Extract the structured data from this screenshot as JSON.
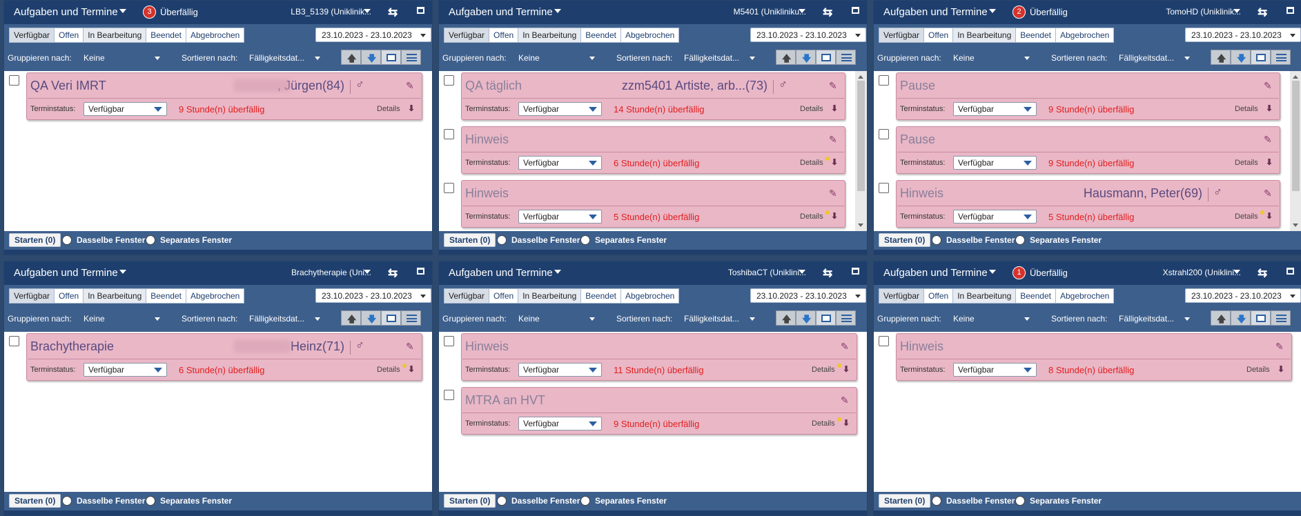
{
  "common": {
    "title": "Aufgaben und Termine",
    "tabs": [
      "Verfügbar",
      "Offen",
      "In Bearbeitung",
      "Beendet",
      "Abgebrochen"
    ],
    "date_range": "23.10.2023 - 23.10.2023",
    "group_label": "Gruppieren nach:",
    "group_value": "Keine",
    "sort_label": "Sortieren nach:",
    "sort_value": "Fälligkeitsdat...",
    "status_label": "Terminstatus:",
    "status_value": "Verfügbar",
    "details": "Details",
    "start_button": "Starten (0)",
    "same_window": "Dasselbe Fenster",
    "separate_window": "Separates Fenster",
    "overdue_text": "Überfällig",
    "colors": {
      "titlebar": "#1e3f6e",
      "toolbar": "#3d5f8c",
      "card": "#e9b7c6",
      "overdue": "#e31d1d",
      "badge": "#d4332c"
    }
  },
  "panels": [
    {
      "device": "LB3_5139 (Uniklinik...",
      "badge": "3",
      "tasks": [
        {
          "title": "QA Veri IMRT",
          "patient": ", Jürgen",
          "age": "(84)",
          "overdue": "9 Stunde(n) überfällig",
          "has_dot": false
        }
      ]
    },
    {
      "device": "M5401 (Unikliniku...",
      "badge": "",
      "tasks": [
        {
          "title": "QA täglich",
          "patient": "zzm5401 Artiste, arb...",
          "age": "(73)",
          "overdue": "14 Stunde(n) überfällig",
          "has_dot": false
        },
        {
          "title": "Hinweis",
          "patient": "",
          "age": "",
          "overdue": "6 Stunde(n) überfällig",
          "has_dot": true
        },
        {
          "title": "Hinweis",
          "patient": "",
          "age": "",
          "overdue": "5 Stunde(n) überfällig",
          "has_dot": true
        }
      ]
    },
    {
      "device": "TomoHD (Uniklinik...",
      "badge": "2",
      "tasks": [
        {
          "title": "Pause",
          "patient": "",
          "age": "",
          "overdue": "9 Stunde(n) überfällig",
          "has_dot": false
        },
        {
          "title": "Pause",
          "patient": "",
          "age": "",
          "overdue": "9 Stunde(n) überfällig",
          "has_dot": false
        },
        {
          "title": "Hinweis",
          "patient": "Hausmann, Peter",
          "age": "(69)",
          "overdue": "5 Stunde(n) überfällig",
          "has_dot": true
        }
      ]
    },
    {
      "device": "Brachytherapie (Uni...",
      "badge": "",
      "tasks": [
        {
          "title": "Brachytherapie",
          "patient": "Heinz",
          "age": "(71)",
          "overdue": "6 Stunde(n) überfällig",
          "has_dot": true
        }
      ]
    },
    {
      "device": "ToshibaCT (Uniklini...",
      "badge": "",
      "tasks": [
        {
          "title": "Hinweis",
          "patient": "",
          "age": "",
          "overdue": "11 Stunde(n) überfällig",
          "has_dot": true
        },
        {
          "title": "MTRA an HVT",
          "patient": "",
          "age": "",
          "overdue": "9 Stunde(n) überfällig",
          "has_dot": true
        }
      ]
    },
    {
      "device": "Xstrahl200 (Uniklini...",
      "badge": "1",
      "tasks": [
        {
          "title": "Hinweis",
          "patient": "",
          "age": "",
          "overdue": "8 Stunde(n) überfällig",
          "has_dot": false
        }
      ]
    }
  ]
}
